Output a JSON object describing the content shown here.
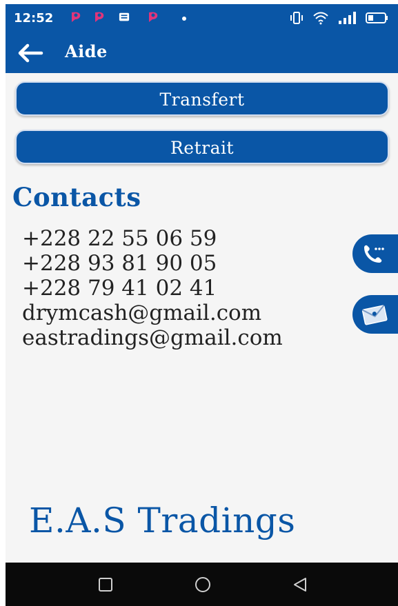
{
  "status_bar": {
    "time": "12:52",
    "icons": [
      "notification-app-icon",
      "notification-app-icon",
      "message-icon",
      "notification-app-icon",
      "vibrate-icon",
      "wifi-icon",
      "signal-icon",
      "battery-icon"
    ]
  },
  "app_bar": {
    "title": "Aide",
    "back_icon": "arrow-left-icon"
  },
  "buttons": {
    "transfer_label": "Transfert",
    "withdrawal_label": "Retrait"
  },
  "contacts": {
    "heading": "Contacts",
    "lines": [
      "+228 22 55 06 59",
      "+228 93 81 90 05",
      "+228 79 41 02 41",
      "drymcash@gmail.com",
      "eastradings@gmail.com"
    ],
    "call_icon": "phone-icon",
    "email_icon": "envelope-icon"
  },
  "brand": {
    "name": "E.A.S Tradings"
  },
  "nav_bar": {
    "icons": [
      "recents-square-icon",
      "home-circle-icon",
      "back-triangle-icon"
    ]
  },
  "colors": {
    "primary": "#0a56a6",
    "background": "#f5f5f5",
    "text": "#222222",
    "notification_accent": "#e0357a"
  }
}
